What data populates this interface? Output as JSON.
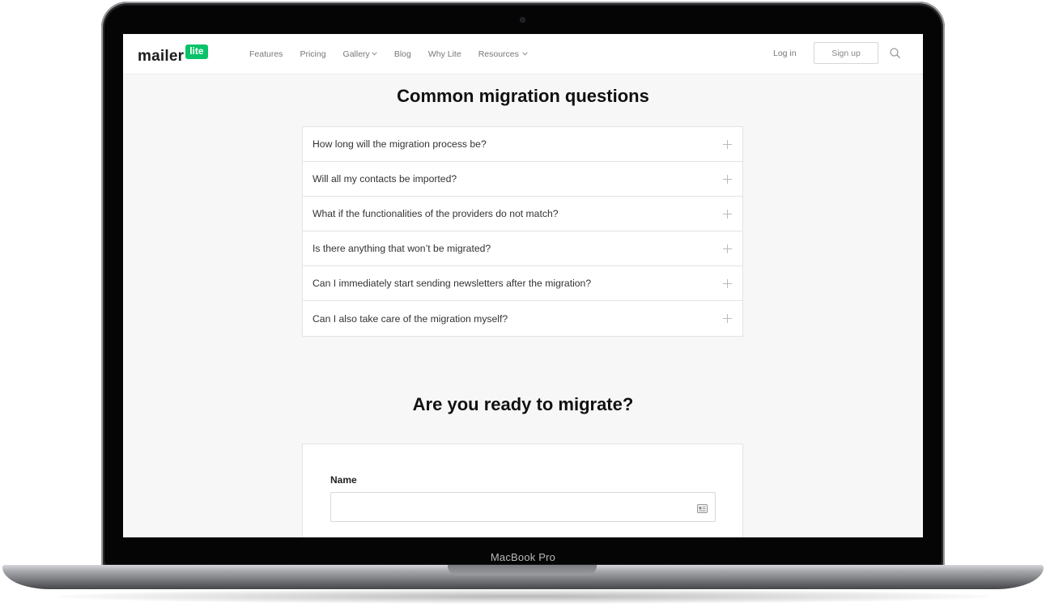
{
  "device": {
    "model_label": "MacBook Pro"
  },
  "nav": {
    "logo_text": "mailer",
    "logo_badge": "lite",
    "links": [
      {
        "label": "Features",
        "has_dropdown": false
      },
      {
        "label": "Pricing",
        "has_dropdown": false
      },
      {
        "label": "Gallery",
        "has_dropdown": true
      },
      {
        "label": "Blog",
        "has_dropdown": false
      },
      {
        "label": "Why Lite",
        "has_dropdown": false
      },
      {
        "label": "Resources",
        "has_dropdown": true
      }
    ],
    "login_label": "Log in",
    "signup_label": "Sign up",
    "icons": [
      "chevron-down-icon",
      "search-icon"
    ]
  },
  "faq": {
    "title": "Common migration questions",
    "items": [
      "How long will the migration process be?",
      "Will all my contacts be imported?",
      "What if the functionalities of the providers do not match?",
      "Is there anything that won’t be migrated?",
      "Can I immediately start sending newsletters after the migration?",
      "Can I also take care of the migration myself?"
    ],
    "expand_icon": "plus-icon"
  },
  "migrate": {
    "title": "Are you ready to migrate?",
    "name_label": "Name",
    "name_value": "",
    "name_placeholder": "",
    "field_icon": "contact-card-icon"
  },
  "colors": {
    "brand_green": "#09c269",
    "page_background": "#f7f7f7",
    "text_dark": "#111111",
    "nav_text": "#777777"
  }
}
